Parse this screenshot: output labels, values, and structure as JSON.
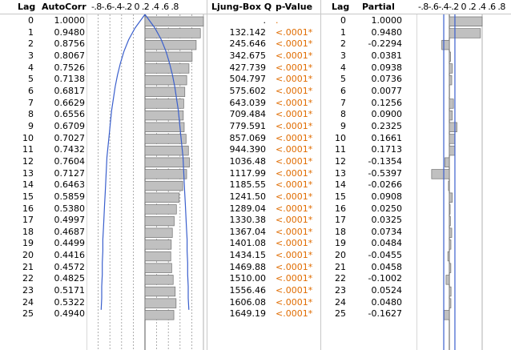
{
  "headers": {
    "lag": "Lag",
    "autocorr": "AutoCorr",
    "acf_scale": "-.8-.6-.4-.2 0 .2 .4 .6 .8",
    "ljung": "Ljung-Box Q",
    "pvalue": "p-Value",
    "lag2": "Lag",
    "partial": "Partial",
    "pacf_scale": "-.8-.6-.4-.2 0 .2 .4 .6 .8"
  },
  "colors": {
    "bar_fill": "#c0c0c0",
    "bar_stroke": "#707070",
    "confidence_curve": "#3a5fcd",
    "pvalue_text": "#e06c00"
  },
  "rows": [
    {
      "lag": "0",
      "autocorr": "1.0000",
      "q": ".",
      "p": ".",
      "partial": "1.0000"
    },
    {
      "lag": "1",
      "autocorr": "0.9480",
      "q": "132.142",
      "p": "<.0001*",
      "partial": "0.9480"
    },
    {
      "lag": "2",
      "autocorr": "0.8756",
      "q": "245.646",
      "p": "<.0001*",
      "partial": "-0.2294"
    },
    {
      "lag": "3",
      "autocorr": "0.8067",
      "q": "342.675",
      "p": "<.0001*",
      "partial": "0.0381"
    },
    {
      "lag": "4",
      "autocorr": "0.7526",
      "q": "427.739",
      "p": "<.0001*",
      "partial": "0.0938"
    },
    {
      "lag": "5",
      "autocorr": "0.7138",
      "q": "504.797",
      "p": "<.0001*",
      "partial": "0.0736"
    },
    {
      "lag": "6",
      "autocorr": "0.6817",
      "q": "575.602",
      "p": "<.0001*",
      "partial": "0.0077"
    },
    {
      "lag": "7",
      "autocorr": "0.6629",
      "q": "643.039",
      "p": "<.0001*",
      "partial": "0.1256"
    },
    {
      "lag": "8",
      "autocorr": "0.6556",
      "q": "709.484",
      "p": "<.0001*",
      "partial": "0.0900"
    },
    {
      "lag": "9",
      "autocorr": "0.6709",
      "q": "779.591",
      "p": "<.0001*",
      "partial": "0.2325"
    },
    {
      "lag": "10",
      "autocorr": "0.7027",
      "q": "857.069",
      "p": "<.0001*",
      "partial": "0.1661"
    },
    {
      "lag": "11",
      "autocorr": "0.7432",
      "q": "944.390",
      "p": "<.0001*",
      "partial": "0.1713"
    },
    {
      "lag": "12",
      "autocorr": "0.7604",
      "q": "1036.48",
      "p": "<.0001*",
      "partial": "-0.1354"
    },
    {
      "lag": "13",
      "autocorr": "0.7127",
      "q": "1117.99",
      "p": "<.0001*",
      "partial": "-0.5397"
    },
    {
      "lag": "14",
      "autocorr": "0.6463",
      "q": "1185.55",
      "p": "<.0001*",
      "partial": "-0.0266"
    },
    {
      "lag": "15",
      "autocorr": "0.5859",
      "q": "1241.50",
      "p": "<.0001*",
      "partial": "0.0908"
    },
    {
      "lag": "16",
      "autocorr": "0.5380",
      "q": "1289.04",
      "p": "<.0001*",
      "partial": "0.0250"
    },
    {
      "lag": "17",
      "autocorr": "0.4997",
      "q": "1330.38",
      "p": "<.0001*",
      "partial": "0.0325"
    },
    {
      "lag": "18",
      "autocorr": "0.4687",
      "q": "1367.04",
      "p": "<.0001*",
      "partial": "0.0734"
    },
    {
      "lag": "19",
      "autocorr": "0.4499",
      "q": "1401.08",
      "p": "<.0001*",
      "partial": "0.0484"
    },
    {
      "lag": "20",
      "autocorr": "0.4416",
      "q": "1434.15",
      "p": "<.0001*",
      "partial": "-0.0455"
    },
    {
      "lag": "21",
      "autocorr": "0.4572",
      "q": "1469.88",
      "p": "<.0001*",
      "partial": "0.0458"
    },
    {
      "lag": "22",
      "autocorr": "0.4825",
      "q": "1510.00",
      "p": "<.0001*",
      "partial": "-0.1002"
    },
    {
      "lag": "23",
      "autocorr": "0.5171",
      "q": "1556.46",
      "p": "<.0001*",
      "partial": "0.0524"
    },
    {
      "lag": "24",
      "autocorr": "0.5322",
      "q": "1606.08",
      "p": "<.0001*",
      "partial": "0.0480"
    },
    {
      "lag": "25",
      "autocorr": "0.4940",
      "q": "1649.19",
      "p": "<.0001*",
      "partial": "-0.1627"
    }
  ],
  "chart_data": [
    {
      "type": "bar",
      "orientation": "horizontal",
      "categories": [
        "0",
        "1",
        "2",
        "3",
        "4",
        "5",
        "6",
        "7",
        "8",
        "9",
        "10",
        "11",
        "12",
        "13",
        "14",
        "15",
        "16",
        "17",
        "18",
        "19",
        "20",
        "21",
        "22",
        "23",
        "24",
        "25"
      ],
      "values": [
        1.0,
        0.948,
        0.8756,
        0.8067,
        0.7526,
        0.7138,
        0.6817,
        0.6629,
        0.6556,
        0.6709,
        0.7027,
        0.7432,
        0.7604,
        0.7127,
        0.6463,
        0.5859,
        0.538,
        0.4997,
        0.4687,
        0.4499,
        0.4416,
        0.4572,
        0.4825,
        0.5171,
        0.5322,
        0.494
      ],
      "xlim": [
        -1,
        1
      ],
      "tick_labels": [
        "-.8",
        "-.6",
        "-.4",
        "-.2",
        "0",
        ".2",
        ".4",
        ".6",
        ".8"
      ],
      "grid": true,
      "confidence_bound_upper": [
        0.0,
        0.17,
        0.28,
        0.36,
        0.42,
        0.47,
        0.51,
        0.54,
        0.57,
        0.59,
        0.61,
        0.63,
        0.65,
        0.66,
        0.67,
        0.68,
        0.69,
        0.7,
        0.71,
        0.72,
        0.72,
        0.73,
        0.73,
        0.74,
        0.74,
        0.75
      ]
    },
    {
      "type": "bar",
      "orientation": "horizontal",
      "categories": [
        "0",
        "1",
        "2",
        "3",
        "4",
        "5",
        "6",
        "7",
        "8",
        "9",
        "10",
        "11",
        "12",
        "13",
        "14",
        "15",
        "16",
        "17",
        "18",
        "19",
        "20",
        "21",
        "22",
        "23",
        "24",
        "25"
      ],
      "values": [
        1.0,
        0.948,
        -0.2294,
        0.0381,
        0.0938,
        0.0736,
        0.0077,
        0.1256,
        0.09,
        0.2325,
        0.1661,
        0.1713,
        -0.1354,
        -0.5397,
        -0.0266,
        0.0908,
        0.025,
        0.0325,
        0.0734,
        0.0484,
        -0.0455,
        0.0458,
        -0.1002,
        0.0524,
        0.048,
        -0.1627
      ],
      "xlim": [
        -1,
        1
      ],
      "tick_labels": [
        "-.8",
        "-.6",
        "-.4",
        "-.2",
        "0",
        ".2",
        ".4",
        ".6",
        ".8"
      ],
      "grid": false,
      "confidence_bound": 0.17
    }
  ]
}
